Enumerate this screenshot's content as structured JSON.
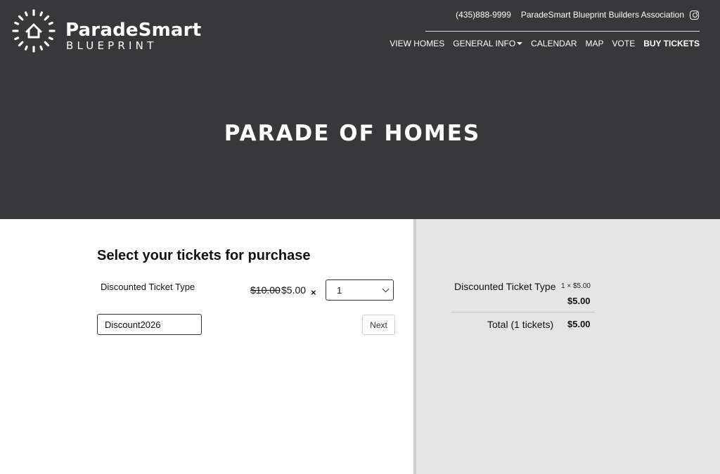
{
  "brand": {
    "name": "ParadeSmart",
    "sub": "BLUEPRINT",
    "logo_icon": "house-sunburst-icon"
  },
  "header": {
    "phone": "(435)888-9999",
    "association": "ParadeSmart Blueprint Builders Association",
    "social_icon": "instagram-icon",
    "nav": {
      "view_homes": "VIEW HOMES",
      "general_info": "GENERAL INFO",
      "calendar": "CALENDAR",
      "map": "MAP",
      "vote": "VOTE",
      "buy_tickets": "BUY TICKETS"
    }
  },
  "hero": {
    "title": "PARADE OF HOMES"
  },
  "purchase": {
    "title": "Select your tickets for purchase",
    "ticket_name": "Discounted Ticket Type",
    "original_price": "$10.00",
    "price": "$5.00",
    "times": "×",
    "quantity": "1",
    "discount_code": "Discount2026",
    "next_label": "Next"
  },
  "summary": {
    "item_name": "Discounted Ticket Type",
    "unit": "1 × $5.00",
    "line_total": "$5.00",
    "total_label": "Total (1 tickets)",
    "total_value": "$5.00"
  },
  "colors": {
    "header_bg": "#38383a",
    "summary_bg": "#e5e5e5",
    "text": "#111111"
  }
}
